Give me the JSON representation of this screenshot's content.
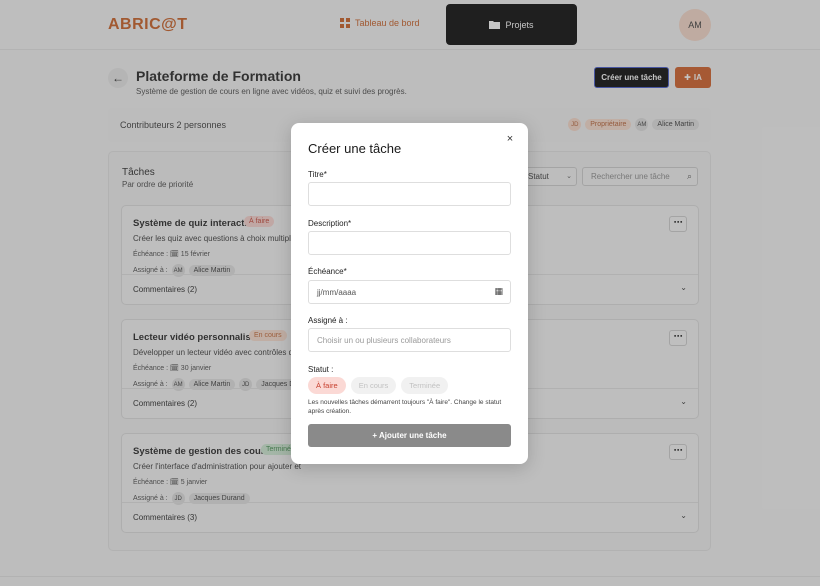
{
  "header": {
    "logo": "ABRIC@T",
    "nav_dashboard": "Tableau de bord",
    "nav_projects": "Projets",
    "avatar": "AM"
  },
  "project": {
    "title": "Plateforme de Formation",
    "subtitle": "Système de gestion de cours en ligne avec vidéos, quiz et suivi des progrès.",
    "create_task_label": "Créer une tâche",
    "ia_label": "IA"
  },
  "contributors": {
    "label": "Contributeurs 2 personnes",
    "items": [
      {
        "initials": "JD",
        "name": "Propriétaire",
        "owner": true
      },
      {
        "initials": "AM",
        "name": "Alice Martin",
        "owner": false
      }
    ]
  },
  "tasks_panel": {
    "title": "Tâches",
    "subtitle": "Par ordre de priorité",
    "status_filter": "Statut",
    "search_placeholder": "Rechercher une tâche"
  },
  "tasks": [
    {
      "name": "Système de quiz interactif",
      "badge": "À faire",
      "description": "Créer les quiz avec questions à choix multiples",
      "due": "Échéance : 🗓 15 février",
      "assign_label": "Assigné à :",
      "assignees": [
        {
          "initials": "AM",
          "name": "Alice Martin"
        }
      ],
      "comments": "Commentaires (2)"
    },
    {
      "name": "Lecteur vidéo personnalisé",
      "badge": "En cours",
      "description": "Développer un lecteur vidéo avec contrôles de",
      "due": "Échéance : 🗓 30 janvier",
      "assign_label": "Assigné à :",
      "assignees": [
        {
          "initials": "AM",
          "name": "Alice Martin"
        },
        {
          "initials": "JD",
          "name": "Jacques Duran"
        }
      ],
      "comments": "Commentaires (2)"
    },
    {
      "name": "Système de gestion des cours",
      "badge": "Terminé",
      "description": "Créer l'interface d'administration pour ajouter et",
      "due": "Échéance : 🗓 5 janvier",
      "assign_label": "Assigné à :",
      "assignees": [
        {
          "initials": "JD",
          "name": "Jacques Durand"
        }
      ],
      "comments": "Commentaires (3)"
    }
  ],
  "modal": {
    "title": "Créer une tâche",
    "close": "×",
    "title_label": "Titre*",
    "title_value": "",
    "description_label": "Description*",
    "description_value": "",
    "due_label": "Échéance*",
    "due_placeholder": "jj/mm/aaaa",
    "assign_label": "Assigné à :",
    "assign_placeholder": "Choisir un ou plusieurs collaborateurs",
    "status_label": "Statut :",
    "status_options": [
      "À faire",
      "En cours",
      "Terminée"
    ],
    "status_note": "Les nouvelles tâches démarrent toujours \"À faire\". Change le statut après création.",
    "submit": "+ Ajouter une tâche"
  },
  "colors": {
    "accent": "#cf5a21",
    "brand": "#c8591d",
    "primary_dark": "#000000"
  }
}
